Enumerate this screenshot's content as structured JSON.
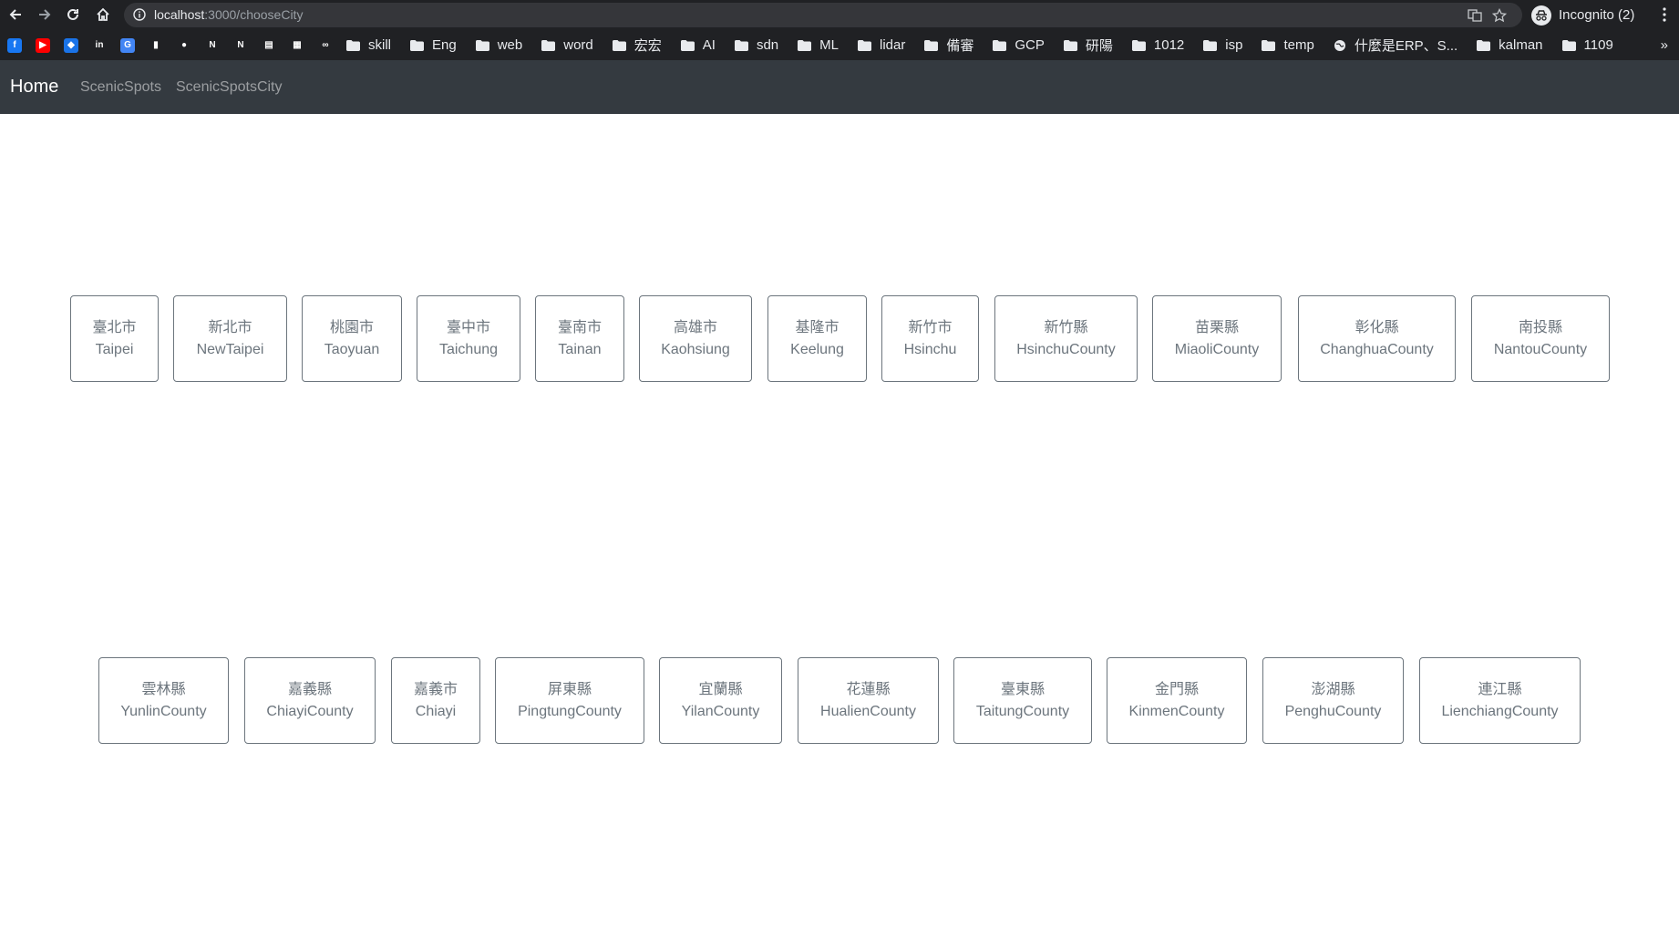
{
  "browser": {
    "url_host": "localhost",
    "url_path": ":3000/chooseCity",
    "incognito_label": "Incognito (2)",
    "bookmarks_favicons": [
      {
        "icon": "facebook-icon",
        "color": "#1877f2",
        "glyph": "f"
      },
      {
        "icon": "youtube-icon",
        "color": "#ff0000",
        "glyph": "▶"
      },
      {
        "icon": "shield-icon",
        "color": "#1a73e8",
        "glyph": "◆"
      },
      {
        "icon": "invision-icon",
        "color": "#202124",
        "glyph": "in"
      },
      {
        "icon": "translate-icon",
        "color": "#4285f4",
        "glyph": "G"
      },
      {
        "icon": "document-icon",
        "color": "#202124",
        "glyph": "▮"
      },
      {
        "icon": "github-icon",
        "color": "#202124",
        "glyph": "●"
      },
      {
        "icon": "notion-icon",
        "color": "#202124",
        "glyph": "N"
      },
      {
        "icon": "netflix-icon",
        "color": "#202124",
        "glyph": "N"
      },
      {
        "icon": "printer-icon",
        "color": "#202124",
        "glyph": "▤"
      },
      {
        "icon": "bus-icon",
        "color": "#202124",
        "glyph": "▦"
      },
      {
        "icon": "link-icon",
        "color": "#202124",
        "glyph": "∞"
      }
    ],
    "bookmarks": [
      {
        "label": "skill",
        "icon": "folder-icon"
      },
      {
        "label": "Eng",
        "icon": "folder-icon"
      },
      {
        "label": "web",
        "icon": "folder-icon"
      },
      {
        "label": "word",
        "icon": "folder-icon"
      },
      {
        "label": "宏宏",
        "icon": "folder-icon"
      },
      {
        "label": "AI",
        "icon": "folder-icon"
      },
      {
        "label": "sdn",
        "icon": "folder-icon"
      },
      {
        "label": "ML",
        "icon": "folder-icon"
      },
      {
        "label": "lidar",
        "icon": "folder-icon"
      },
      {
        "label": "備審",
        "icon": "folder-icon"
      },
      {
        "label": "GCP",
        "icon": "folder-icon"
      },
      {
        "label": "研陽",
        "icon": "folder-icon"
      },
      {
        "label": "1012",
        "icon": "folder-icon"
      },
      {
        "label": "isp",
        "icon": "folder-icon"
      },
      {
        "label": "temp",
        "icon": "folder-icon"
      },
      {
        "label": "什麼是ERP、S...",
        "icon": "globe-icon"
      },
      {
        "label": "kalman",
        "icon": "folder-icon"
      },
      {
        "label": "1109",
        "icon": "folder-icon"
      }
    ],
    "more_label": "»"
  },
  "navbar": {
    "brand": "Home",
    "links": [
      "ScenicSpots",
      "ScenicSpotsCity"
    ],
    "color": "#343a40"
  },
  "cities_row1": [
    {
      "zh": "臺北市",
      "en": "Taipei"
    },
    {
      "zh": "新北市",
      "en": "NewTaipei"
    },
    {
      "zh": "桃園市",
      "en": "Taoyuan"
    },
    {
      "zh": "臺中市",
      "en": "Taichung"
    },
    {
      "zh": "臺南市",
      "en": "Tainan"
    },
    {
      "zh": "高雄市",
      "en": "Kaohsiung"
    },
    {
      "zh": "基隆市",
      "en": "Keelung"
    },
    {
      "zh": "新竹市",
      "en": "Hsinchu"
    },
    {
      "zh": "新竹縣",
      "en": "HsinchuCounty"
    },
    {
      "zh": "苗栗縣",
      "en": "MiaoliCounty"
    },
    {
      "zh": "彰化縣",
      "en": "ChanghuaCounty"
    },
    {
      "zh": "南投縣",
      "en": "NantouCounty"
    }
  ],
  "cities_row2": [
    {
      "zh": "雲林縣",
      "en": "YunlinCounty"
    },
    {
      "zh": "嘉義縣",
      "en": "ChiayiCounty"
    },
    {
      "zh": "嘉義市",
      "en": "Chiayi"
    },
    {
      "zh": "屏東縣",
      "en": "PingtungCounty"
    },
    {
      "zh": "宜蘭縣",
      "en": "YilanCounty"
    },
    {
      "zh": "花蓮縣",
      "en": "HualienCounty"
    },
    {
      "zh": "臺東縣",
      "en": "TaitungCounty"
    },
    {
      "zh": "金門縣",
      "en": "KinmenCounty"
    },
    {
      "zh": "澎湖縣",
      "en": "PenghuCounty"
    },
    {
      "zh": "連江縣",
      "en": "LienchiangCounty"
    }
  ],
  "button_color": "#6c757d"
}
